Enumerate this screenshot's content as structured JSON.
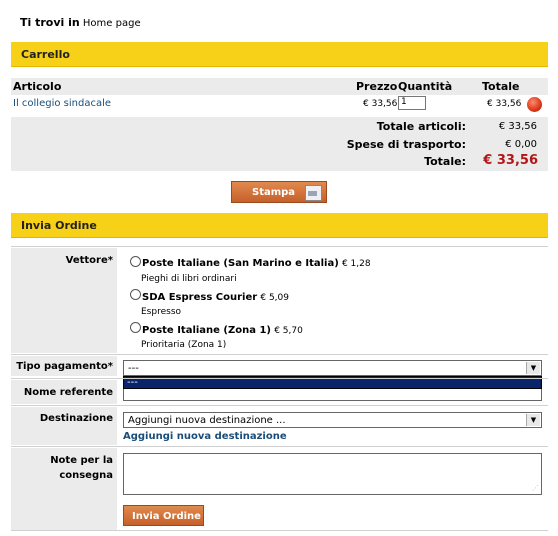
{
  "breadcrumb": {
    "label": "Ti trovi in",
    "page": "Home page"
  },
  "cart": {
    "title": "Carrello",
    "columns": {
      "article": "Articolo",
      "price": "Prezzo",
      "qty": "Quantità",
      "total": "Totale"
    },
    "item": {
      "name": "Il collegio sindacale",
      "price": "€ 33,56",
      "qty": "1",
      "total": "€ 33,56"
    },
    "totals": {
      "items_label": "Totale articoli:",
      "items_value": "€ 33,56",
      "shipping_label": "Spese di trasporto:",
      "shipping_value": "€ 0,00",
      "grand_label": "Totale:",
      "grand_value": "€ 33,56"
    },
    "print_label": "Stampa"
  },
  "order": {
    "title": "Invia Ordine",
    "carrier_label": "Vettore*",
    "carriers": [
      {
        "name": "Poste Italiane (San Marino e Italia)",
        "price": "€ 1,28",
        "desc": "Pieghi di libri ordinari"
      },
      {
        "name": "SDA Espress Courier",
        "price": "€ 5,09",
        "desc": "Espresso"
      },
      {
        "name": "Poste Italiane (Zona 1)",
        "price": "€ 5,70",
        "desc": "Prioritaria (Zona 1)"
      }
    ],
    "payment_label": "Tipo pagamento*",
    "payment_value": "---",
    "payment_option": "---",
    "referent_label": "Nome referente",
    "dest_label": "Destinazione",
    "dest_value": "Aggiungi nuova destinazione ...",
    "dest_link": "Aggiungi nuova destinazione",
    "notes_label": "Note per la consegna",
    "submit_label": "Invia Ordine"
  },
  "colors": {
    "accent": "#f7d117",
    "price_red": "#b01818",
    "link": "#1a4d7a",
    "selected": "#0a246a"
  }
}
